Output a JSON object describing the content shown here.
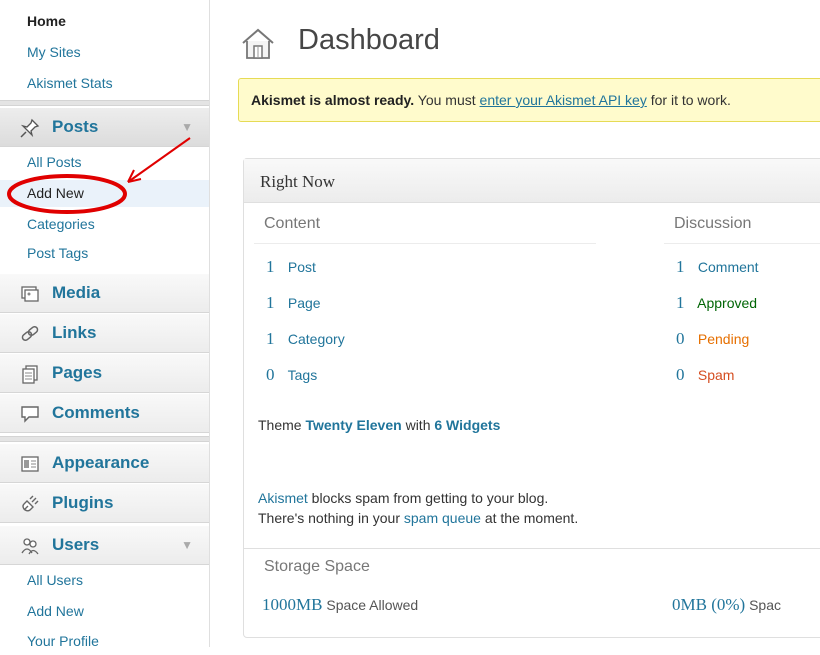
{
  "sidebar": {
    "top_items": [
      "Home",
      "My Sites",
      "Akismet Stats"
    ],
    "posts": {
      "label": "Posts",
      "sub": [
        "All Posts",
        "Add New",
        "Categories",
        "Post Tags"
      ]
    },
    "media": "Media",
    "links": "Links",
    "pages": "Pages",
    "comments": "Comments",
    "appearance": "Appearance",
    "plugins": "Plugins",
    "users": {
      "label": "Users",
      "sub": [
        "All Users",
        "Add New",
        "Your Profile"
      ]
    },
    "collapse_arrow": "▼"
  },
  "header": {
    "title": "Dashboard"
  },
  "notice": {
    "bold": "Akismet is almost ready.",
    "text1": " You must ",
    "link": "enter your Akismet API key",
    "text2": " for it to work."
  },
  "right_now": {
    "title": "Right Now",
    "content_heading": "Content",
    "discussion_heading": "Discussion",
    "content": [
      {
        "count": "1",
        "label": "Post"
      },
      {
        "count": "1",
        "label": "Page"
      },
      {
        "count": "1",
        "label": "Category"
      },
      {
        "count": "0",
        "label": "Tags"
      }
    ],
    "discussion": [
      {
        "count": "1",
        "label": "Comment"
      },
      {
        "count": "1",
        "label": "Approved"
      },
      {
        "count": "0",
        "label": "Pending"
      },
      {
        "count": "0",
        "label": "Spam"
      }
    ],
    "theme": {
      "prefix": "Theme ",
      "name": "Twenty Eleven",
      "mid": " with ",
      "widgets": "6 Widgets"
    },
    "akismet": {
      "link1": "Akismet",
      "text1": " blocks spam from getting to your blog.",
      "text2": "There's nothing in your ",
      "link2": "spam queue",
      "text3": " at the moment."
    },
    "storage": {
      "title": "Storage Space",
      "allowed_value": "1000MB",
      "allowed_label": "Space Allowed",
      "used_value": "0MB (0%)",
      "used_label": "Spac"
    }
  },
  "colors": {
    "link": "#21759b",
    "notice_bg": "#fffbcc",
    "approved": "#006505",
    "pending": "#e66f00",
    "spam": "#d54e21",
    "annotation": "#e00000"
  }
}
